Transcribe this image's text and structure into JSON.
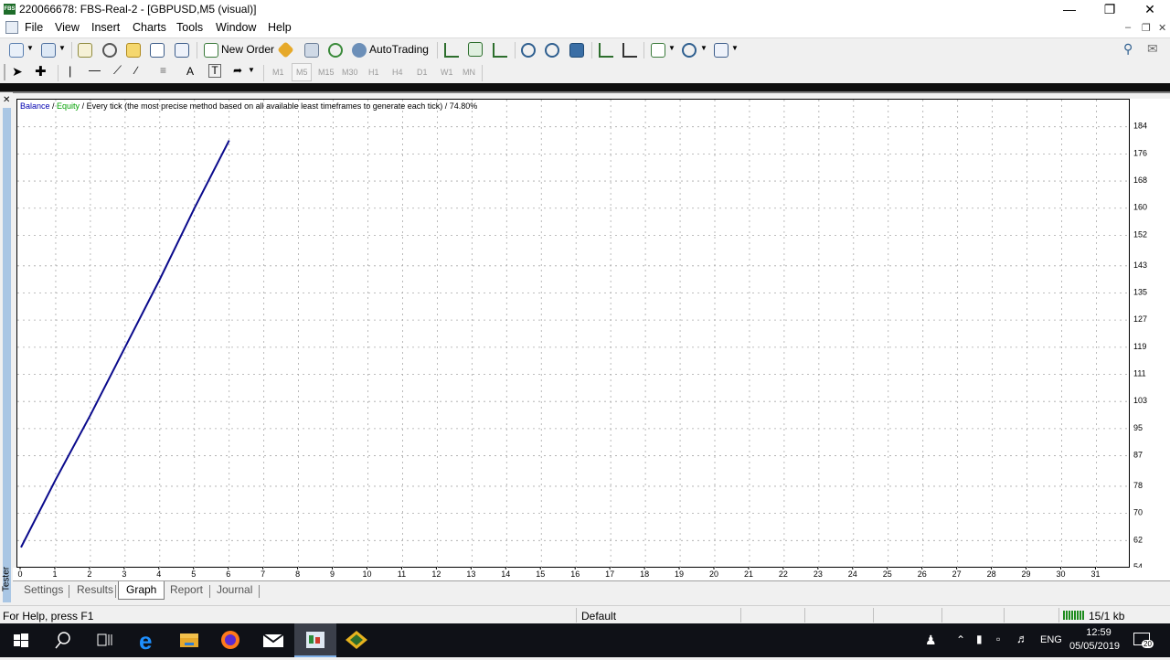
{
  "window": {
    "title": "220066678: FBS-Real-2 - [GBPUSD,M5 (visual)]",
    "app_badge": "FBS"
  },
  "menu": [
    "File",
    "View",
    "Insert",
    "Charts",
    "Tools",
    "Window",
    "Help"
  ],
  "toolbar": {
    "new_order_label": "New Order",
    "autotrading_label": "AutoTrading"
  },
  "timeframes": [
    "M1",
    "M5",
    "M15",
    "M30",
    "H1",
    "H4",
    "D1",
    "W1",
    "MN"
  ],
  "chart_data": {
    "type": "line",
    "legend": {
      "balance": "Balance",
      "slash1": " / ",
      "equity": "Equity",
      "description": " / Every tick (the most precise method based on all available least timeframes to generate each tick) / 74.80%"
    },
    "x_ticks": [
      0,
      1,
      2,
      3,
      4,
      5,
      6,
      7,
      8,
      9,
      10,
      11,
      12,
      13,
      14,
      15,
      16,
      17,
      18,
      19,
      20,
      21,
      22,
      23,
      24,
      25,
      26,
      27,
      28,
      29,
      30,
      31
    ],
    "y_ticks": [
      184,
      176,
      168,
      160,
      152,
      143,
      135,
      127,
      119,
      111,
      103,
      95,
      87,
      78,
      70,
      62,
      54
    ],
    "xlim": [
      0,
      32
    ],
    "ylim": [
      54,
      192
    ],
    "series": [
      {
        "name": "Balance",
        "color": "#0a0a8c",
        "x": [
          0,
          1,
          2,
          3,
          4,
          5,
          6
        ],
        "y": [
          60,
          80,
          99,
          119,
          139,
          160,
          180
        ]
      }
    ],
    "colors": {
      "balance": "#0000b0",
      "equity": "#00a000",
      "text": "#000000"
    }
  },
  "tabs": {
    "vertical_label": "Tester",
    "items": [
      "Settings",
      "Results",
      "Graph",
      "Report",
      "Journal"
    ],
    "active": "Graph"
  },
  "status": {
    "help": "For Help, press F1",
    "profile": "Default",
    "traffic": "15/1 kb"
  },
  "taskbar": {
    "language": "ENG",
    "time": "12:59",
    "date": "05/05/2019",
    "notifications": "20"
  }
}
